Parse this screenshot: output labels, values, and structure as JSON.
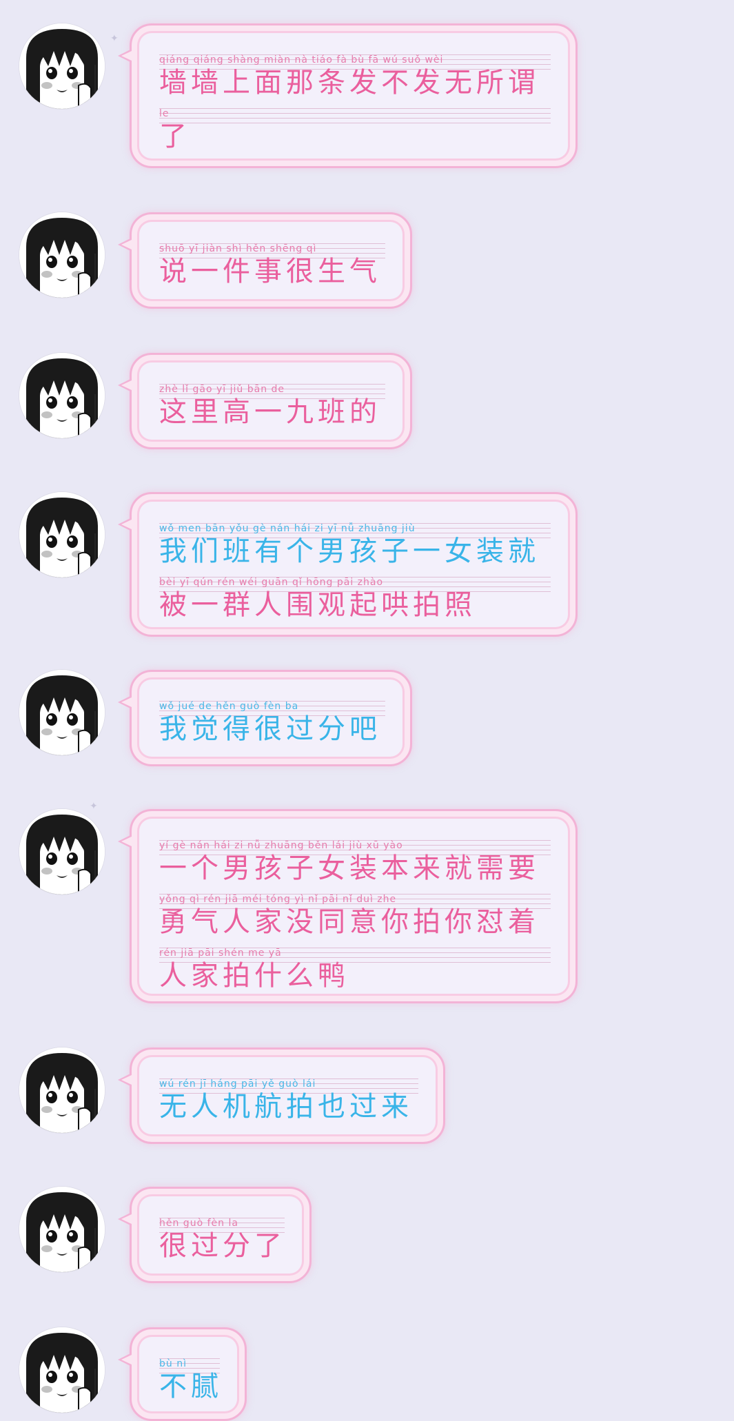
{
  "colors": {
    "background": "#e9e8f5",
    "bubble_border": "#f3b3d6",
    "pink_text": "#ea5f9d",
    "blue_text": "#39b4e8"
  },
  "messages": [
    {
      "lines": [
        {
          "pinyin": "qiáng qiáng shàng miàn nà tiáo fà bù fā wú suǒ wèi",
          "text": "墙墙上面那条发不发无所谓",
          "color": "pink"
        },
        {
          "pinyin": "le",
          "text": "了",
          "color": "pink"
        }
      ]
    },
    {
      "lines": [
        {
          "pinyin": "shuō yī jiàn shì hěn shēng qì",
          "text": "说一件事很生气",
          "color": "pink"
        }
      ]
    },
    {
      "lines": [
        {
          "pinyin": "zhè lǐ gāo yī jiǔ bān de",
          "text": "这里高一九班的",
          "color": "pink"
        }
      ]
    },
    {
      "lines": [
        {
          "pinyin": "wǒ men bān yǒu gè nán hái zi yī nǚ zhuāng jiù",
          "text": "我们班有个男孩子一女装就",
          "color": "blue"
        },
        {
          "pinyin": "bèi yī qún rén wéi guān qǐ hōng pāi zhào",
          "text": "被一群人围观起哄拍照",
          "color": "pink"
        }
      ]
    },
    {
      "lines": [
        {
          "pinyin": "wǒ jué de hěn guò fèn ba",
          "text": "我觉得很过分吧",
          "color": "blue"
        }
      ]
    },
    {
      "lines": [
        {
          "pinyin": "yí gè nán hái zi nǚ zhuāng běn lái jiù xū yào",
          "text": "一个男孩子女装本来就需要",
          "color": "pink"
        },
        {
          "pinyin": "yǒng qì rén jiā méi tóng yì nǐ pāi nǐ duì zhe",
          "text": "勇气人家没同意你拍你怼着",
          "color": "pink"
        },
        {
          "pinyin": "rén jiā pāi shén me yā",
          "text": "人家拍什么鸭",
          "color": "pink"
        }
      ]
    },
    {
      "lines": [
        {
          "pinyin": "wú rén jī háng pāi yě guò lái",
          "text": "无人机航拍也过来",
          "color": "blue"
        }
      ]
    },
    {
      "lines": [
        {
          "pinyin": "hěn guò fèn la",
          "text": "很过分了",
          "color": "pink"
        }
      ]
    },
    {
      "lines": [
        {
          "pinyin": "bù nì",
          "text": "不腻",
          "color": "blue"
        }
      ]
    }
  ]
}
